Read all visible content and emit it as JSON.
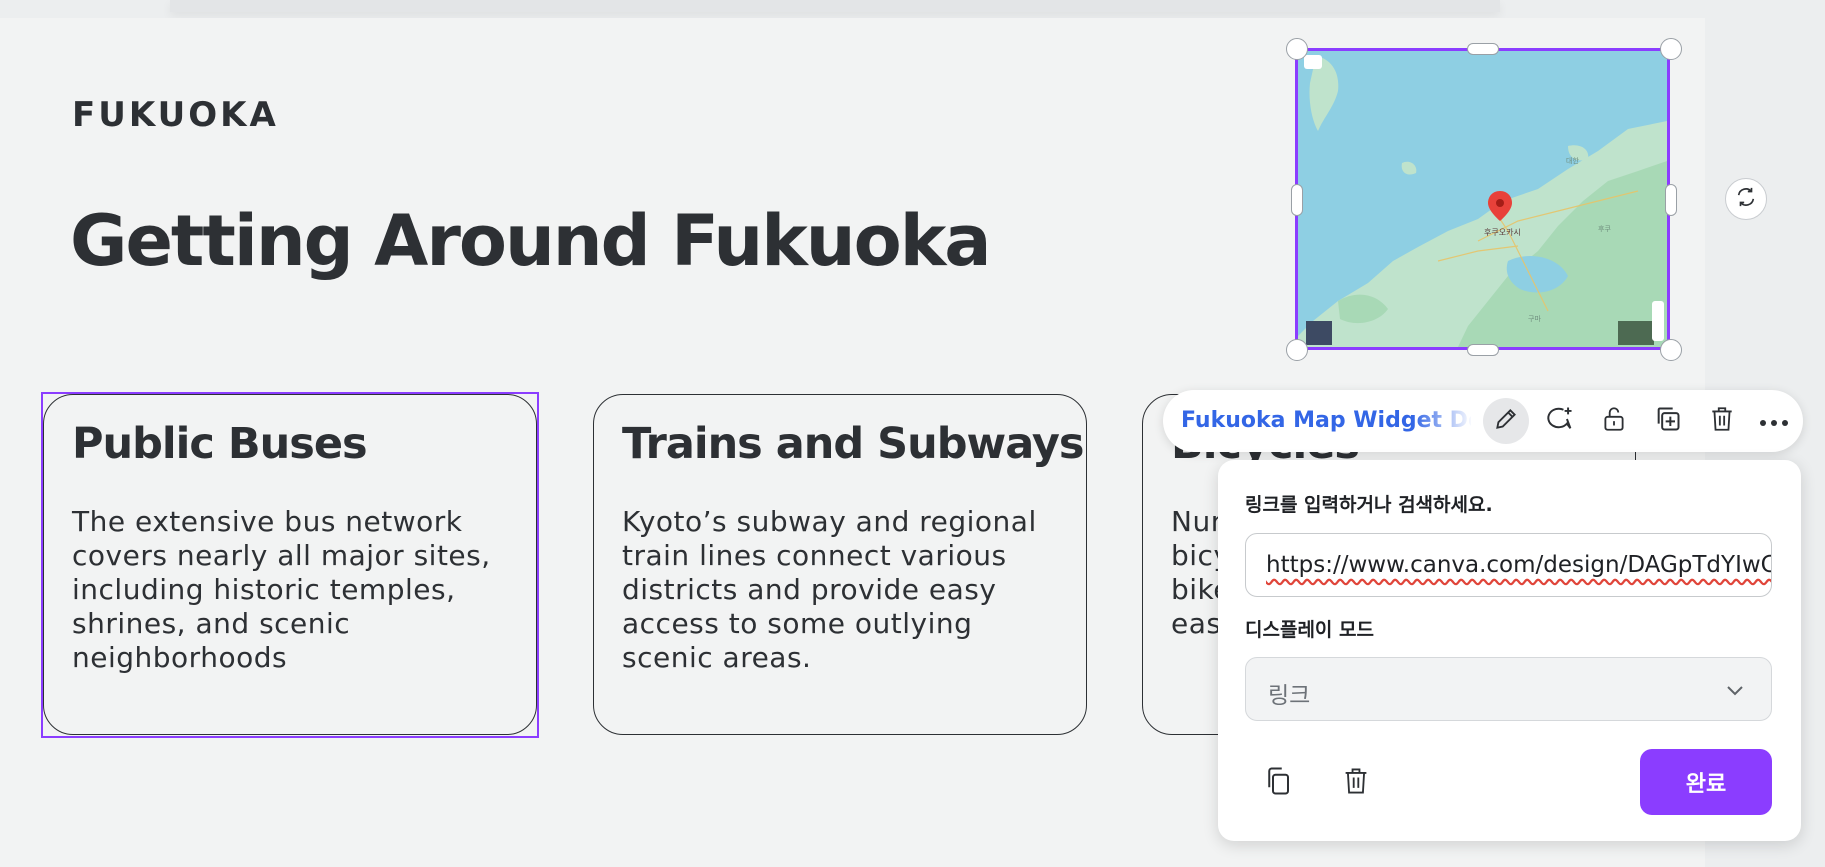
{
  "slide": {
    "eyebrow": "FUKUOKA",
    "title": "Getting Around Fukuoka",
    "cards": [
      {
        "title": "Public Buses",
        "body": "The extensive bus network covers nearly all major sites, including historic temples, shrines, and scenic neighborhoods"
      },
      {
        "title": "Trains and Subways",
        "body": "Kyoto’s subway and regional train lines connect various districts and provide easy access to some outlying scenic areas."
      },
      {
        "title": "Bicycles",
        "body": "Num bicy bike eas"
      }
    ]
  },
  "map": {
    "marker_label": "후쿠오카시"
  },
  "toolbar": {
    "link_text": "Fukuoka Map Widget Deve",
    "icons": [
      "pencil-icon",
      "comment-add-icon",
      "lock-open-icon",
      "duplicate-icon",
      "trash-icon",
      "more-icon"
    ]
  },
  "link_popup": {
    "url_label": "링크를 입력하거나 검색하세요.",
    "url_value": "https://www.canva.com/design/DAGpTdYIwC",
    "display_mode_label": "디스플레이 모드",
    "display_mode_value": "링크",
    "done_label": "완료"
  },
  "colors": {
    "accent": "#8b3dff",
    "link": "#3366e6",
    "text": "#2d3034"
  }
}
